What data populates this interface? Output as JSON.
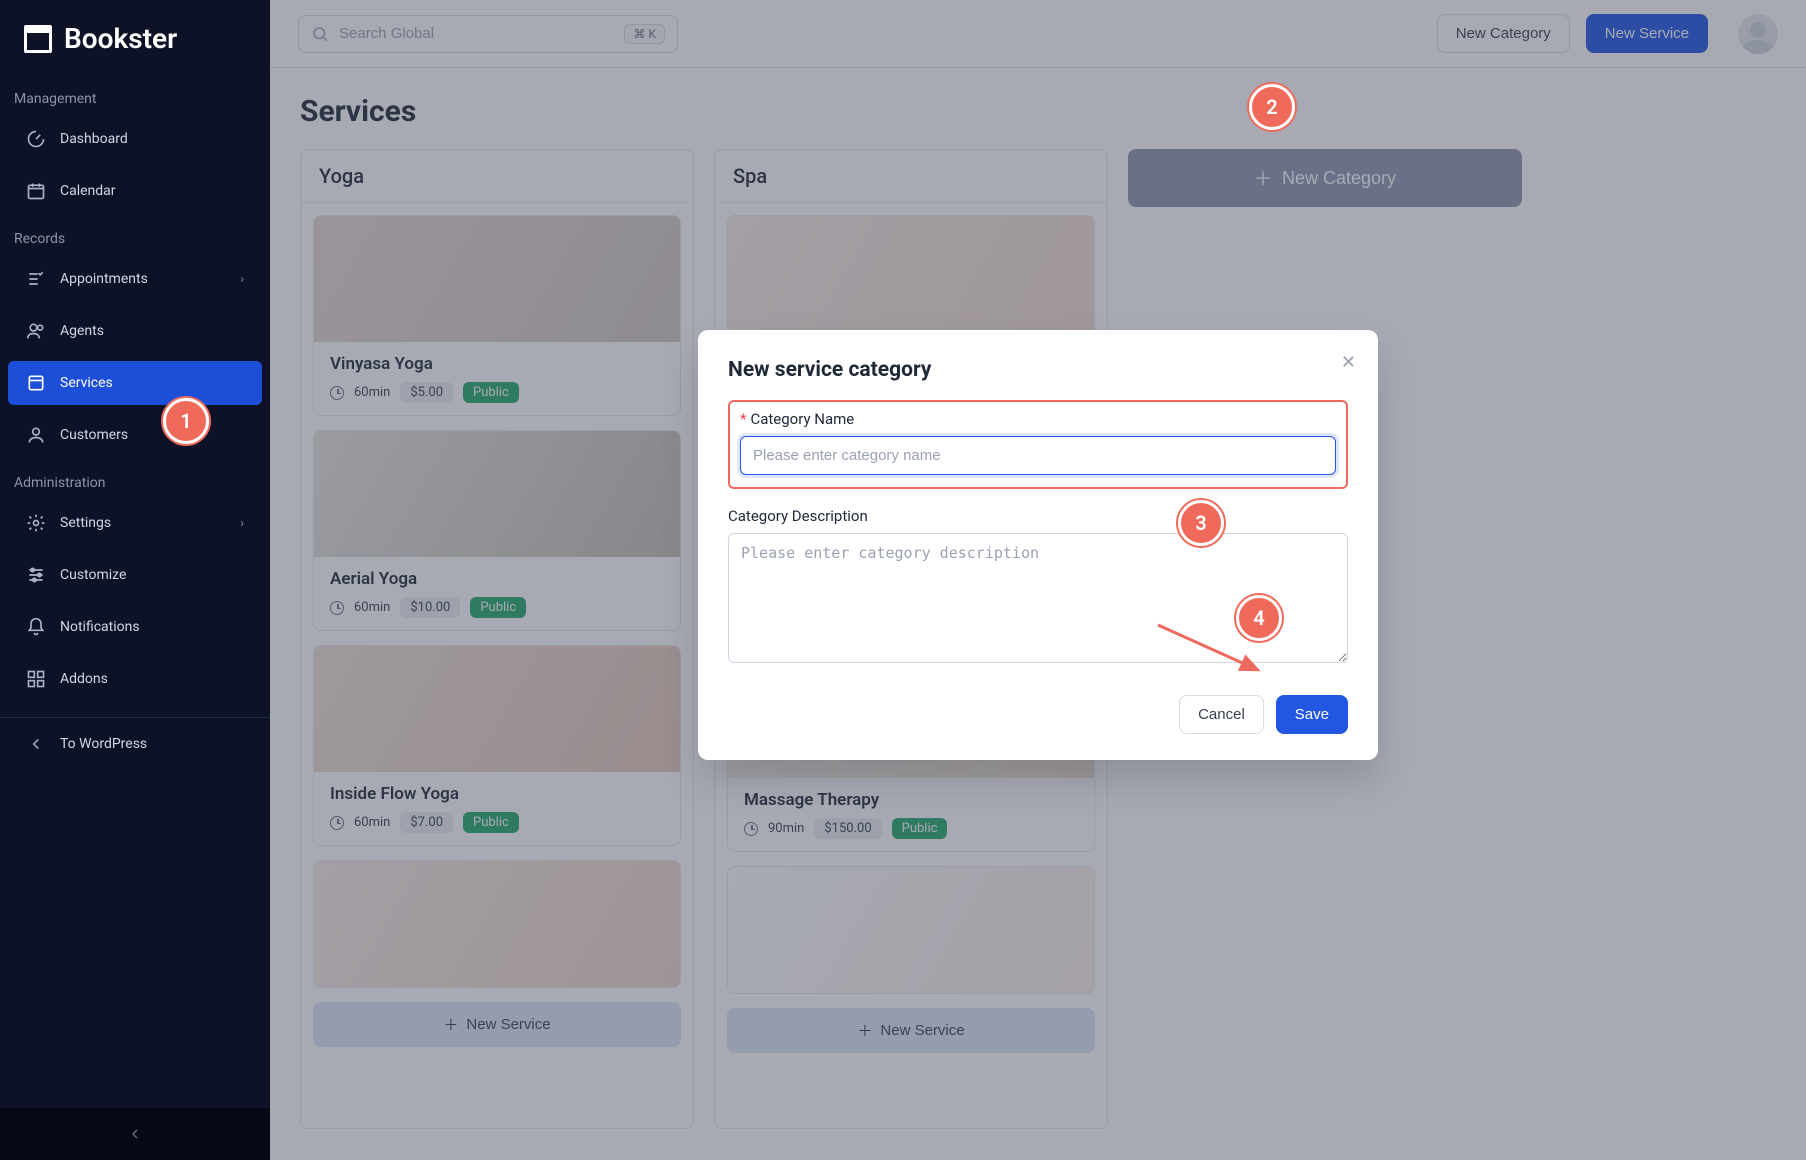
{
  "brand": "Bookster",
  "search": {
    "placeholder": "Search Global",
    "shortcut": "⌘ K"
  },
  "topbar": {
    "new_category": "New Category",
    "new_service": "New Service"
  },
  "sidebar": {
    "sections": {
      "management": "Management",
      "records": "Records",
      "administration": "Administration"
    },
    "items": {
      "dashboard": "Dashboard",
      "calendar": "Calendar",
      "appointments": "Appointments",
      "agents": "Agents",
      "services": "Services",
      "customers": "Customers",
      "settings": "Settings",
      "customize": "Customize",
      "notifications": "Notifications",
      "addons": "Addons"
    },
    "to_wordpress": "To WordPress"
  },
  "page": {
    "title": "Services"
  },
  "columns": [
    {
      "title": "Yoga",
      "cards": [
        {
          "title": "Vinyasa Yoga",
          "duration": "60min",
          "price": "$5.00",
          "visibility": "Public"
        },
        {
          "title": "Aerial Yoga",
          "duration": "60min",
          "price": "$10.00",
          "visibility": "Public"
        },
        {
          "title": "Inside Flow Yoga",
          "duration": "60min",
          "price": "$7.00",
          "visibility": "Public"
        }
      ],
      "add_label": "New Service"
    },
    {
      "title": "Spa",
      "cards": [
        {
          "title": "Massage Therapy",
          "duration": "90min",
          "price": "$150.00",
          "visibility": "Public"
        }
      ],
      "add_label": "New Service"
    }
  ],
  "new_category_button": "New Category",
  "modal": {
    "title": "New service category",
    "name_label": "Category Name",
    "name_placeholder": "Please enter category name",
    "desc_label": "Category Description",
    "desc_placeholder": "Please enter category description",
    "cancel": "Cancel",
    "save": "Save"
  },
  "annotations": {
    "a1": "1",
    "a2": "2",
    "a3": "3",
    "a4": "4"
  }
}
